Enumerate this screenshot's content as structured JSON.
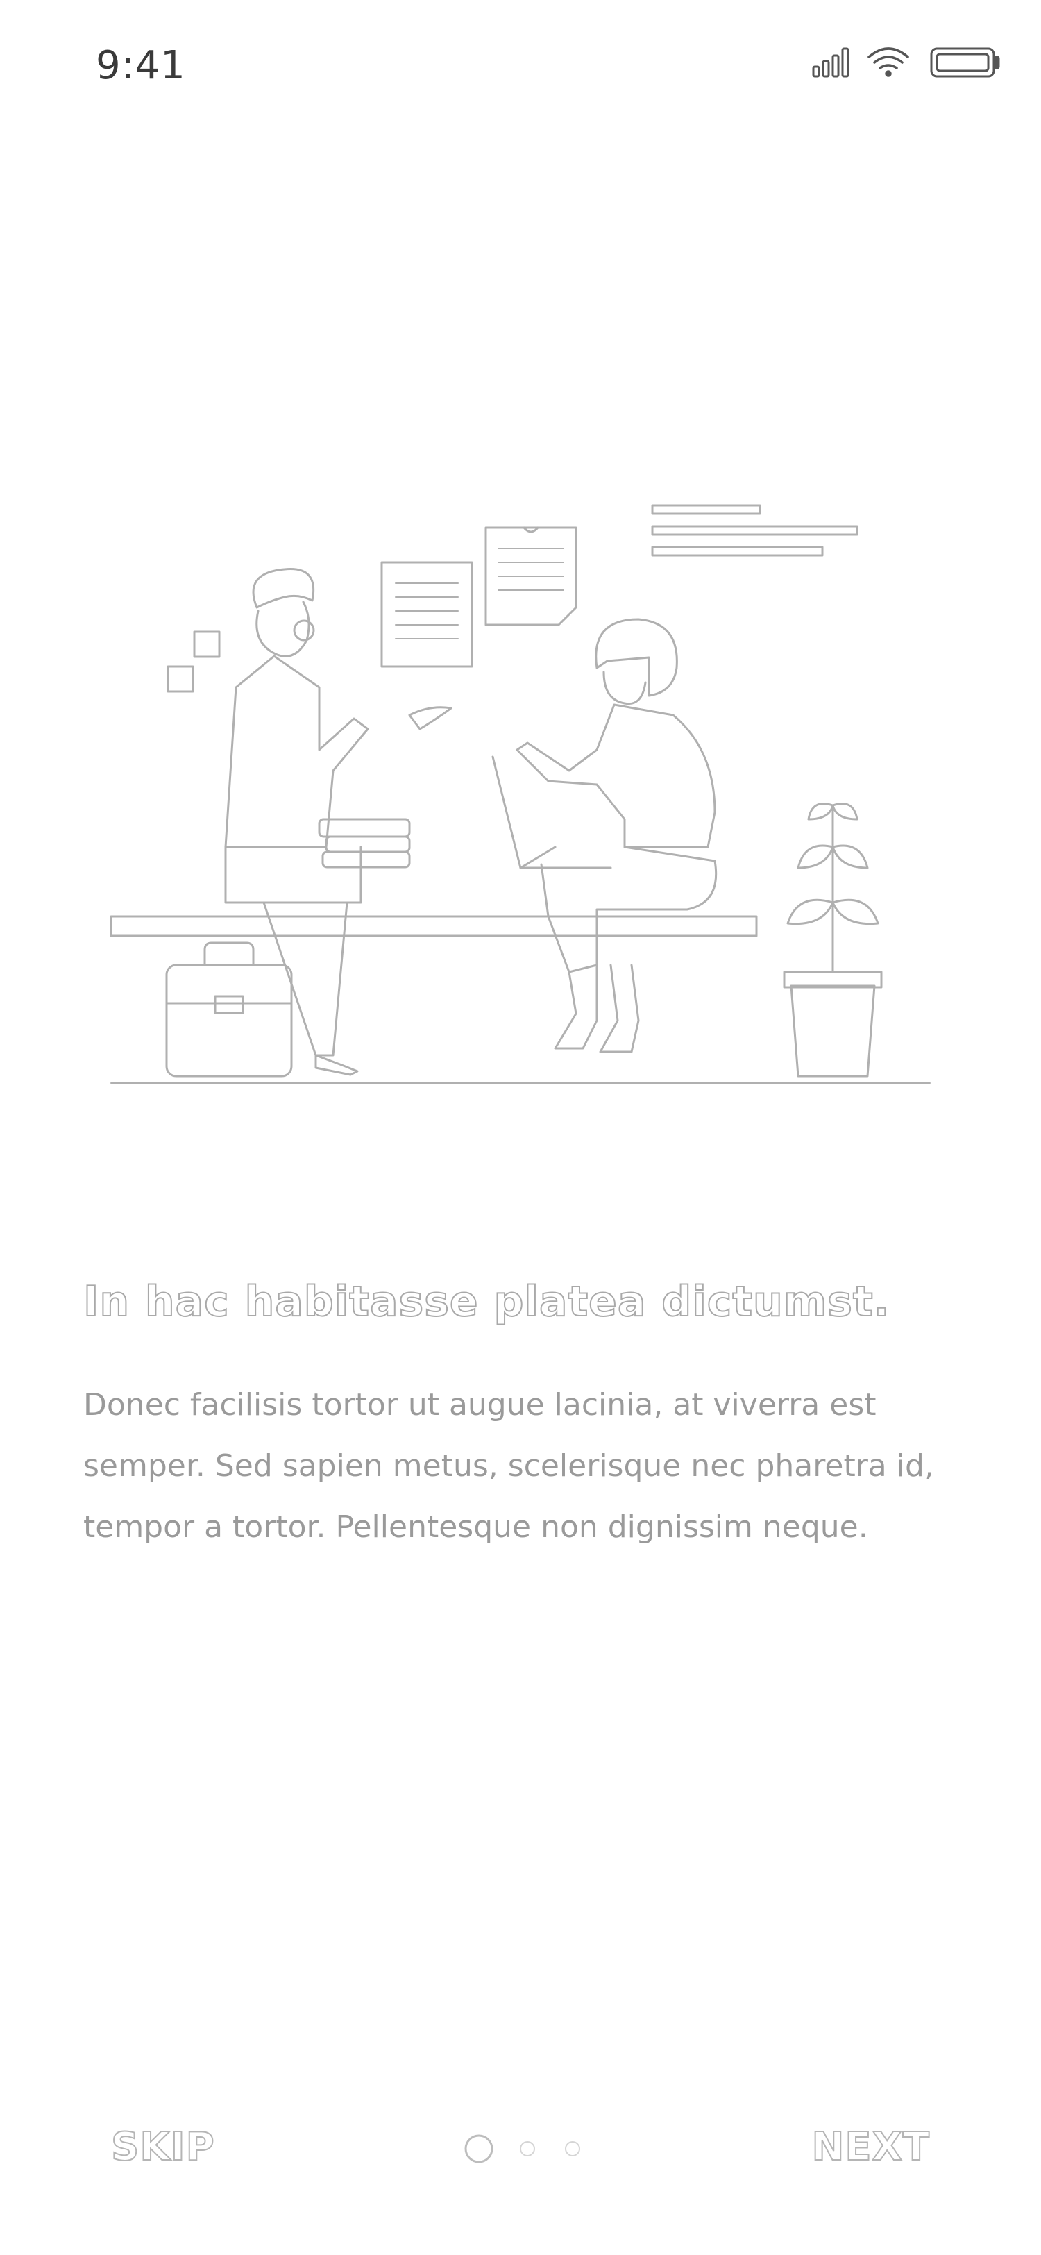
{
  "status_bar": {
    "time": "9:41",
    "icons": [
      "signal-icon",
      "wifi-icon",
      "battery-icon"
    ]
  },
  "onboarding": {
    "illustration": "people-talking-illustration",
    "headline": "In hac habitasse platea dictumst.",
    "body": "Donec facilisis tortor ut augue lacinia, at viverra est semper. Sed sapien metus, scelerisque nec pharetra id, tempor a tortor. Pellentesque non dignissim neque."
  },
  "footer": {
    "skip_label": "SKIP",
    "next_label": "NEXT",
    "page_count": 3,
    "current_page": 1
  }
}
